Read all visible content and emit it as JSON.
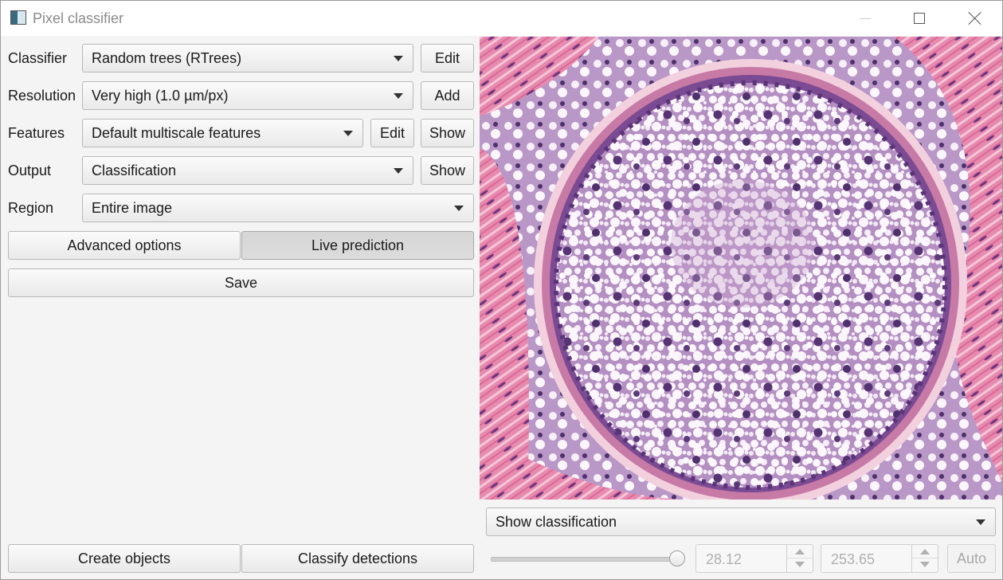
{
  "window": {
    "title": "Pixel classifier",
    "icon": "app-window-icon"
  },
  "form": {
    "classifier": {
      "label": "Classifier",
      "value": "Random trees (RTrees)",
      "button": "Edit"
    },
    "resolution": {
      "label": "Resolution",
      "value": "Very high (1.0 µm/px)",
      "button": "Add"
    },
    "features": {
      "label": "Features",
      "value": "Default multiscale features",
      "edit_button": "Edit",
      "show_button": "Show"
    },
    "output": {
      "label": "Output",
      "value": "Classification",
      "button": "Show"
    },
    "region": {
      "label": "Region",
      "value": "Entire image"
    }
  },
  "actions": {
    "advanced_options": "Advanced options",
    "live_prediction": "Live prediction",
    "save": "Save",
    "create_objects": "Create objects",
    "classify_detections": "Classify detections"
  },
  "viewer": {
    "display_mode": "Show classification",
    "opacity_slider_level": 1.0,
    "min_value": "28.12",
    "max_value": "253.65",
    "auto_button": "Auto"
  },
  "colors": {
    "tissue_pink": "#e07aa0",
    "tissue_purple": "#a57fb2",
    "nucleus": "#4a2d68",
    "vacuole": "#fbf6fb"
  }
}
